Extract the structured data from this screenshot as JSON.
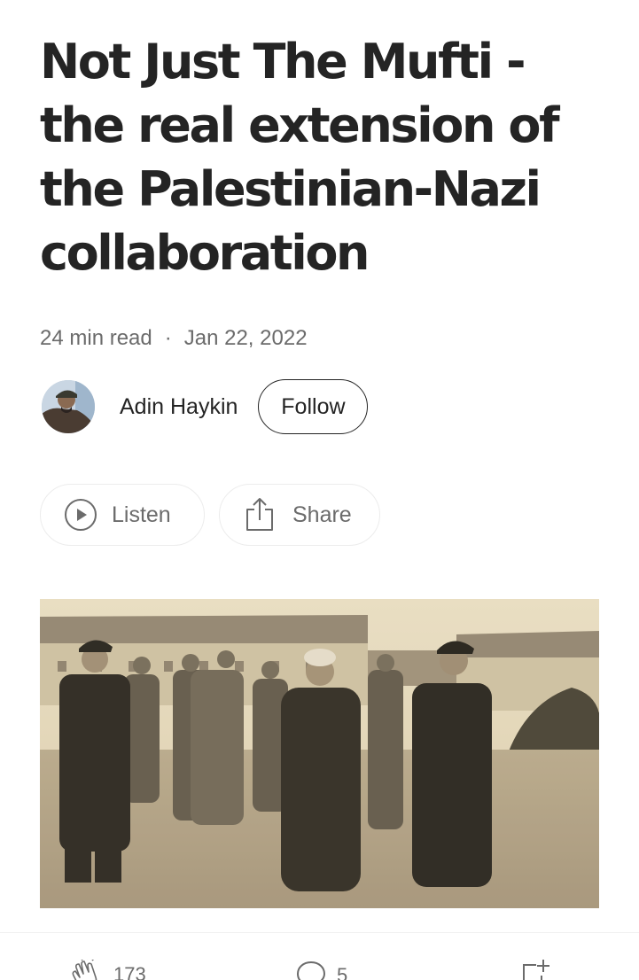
{
  "article": {
    "title": "Not Just The Mufti - the real extension of the Palestinian-Nazi collaboration",
    "read_time": "24 min read",
    "separator": "·",
    "date": "Jan 22, 2022"
  },
  "author": {
    "name": "Adin Haykin",
    "follow_label": "Follow"
  },
  "actions": {
    "listen_label": "Listen",
    "share_label": "Share"
  },
  "hero_image": {
    "alt": "Historical sepia photograph"
  },
  "bottom_bar": {
    "clap_count": "173",
    "comment_count": "5"
  },
  "icons": {
    "listen": "play-circle-icon",
    "share": "share-icon",
    "clap": "clap-icon",
    "comment": "comment-icon",
    "save": "bookmark-add-icon"
  },
  "colors": {
    "text": "#242424",
    "muted": "#6b6b6b",
    "border": "#ececec"
  }
}
